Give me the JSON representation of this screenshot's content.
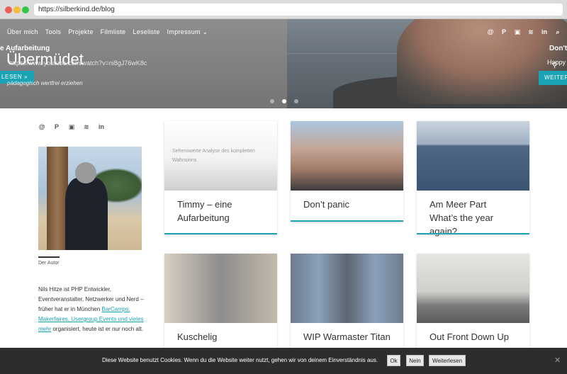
{
  "browser": {
    "url": "https://silberkind.de/blog"
  },
  "nav": {
    "items": [
      "Über mich",
      "Tools",
      "Projekte",
      "Filmliste",
      "Leseliste",
      "Impressum"
    ],
    "dropdown_suffix": "⌄"
  },
  "hero": {
    "prev_slide_title": "e Aufarbeitung",
    "big_title": "Übermüdet",
    "url_fragment": "https://www.youtube.com/watch?v=ni8gJ76wK8c",
    "left_button": "LESEN »",
    "subtitle": "pädagogisch wertfrei erziehen",
    "next_slide_title": "Don't",
    "next_slide_sub": "Happy",
    "right_button": "WEITER",
    "active_dot": 1
  },
  "sidebar": {
    "author_caption": "Der Autor",
    "bio_1": "Nils Hitze ist PHP Entwickler, Eventveranstalter, Netzwerker und Nerd – früher hat er in München ",
    "bio_link": "BarCamps, Makerfaires, Usergroup Events und vieles mehr",
    "bio_2": " organisiert, heute ist er nur noch alt."
  },
  "cards": [
    {
      "title": "Timmy – eine Aufarbeitung",
      "overlay": "Sehenswerte Analyse des kompletten Wahnsinns"
    },
    {
      "title": "Don’t panic"
    },
    {
      "title": "Am Meer Part What’s the year again?"
    },
    {
      "title": "Kuschelig"
    },
    {
      "title": "WIP Warmaster Titan"
    },
    {
      "title": "Out Front Down Up"
    }
  ],
  "cookie": {
    "text": "Diese Website benutzt Cookies. Wenn du die Website weiter nutzt, gehen wir von deinem Einverständnis aus.",
    "ok": "Ok",
    "nein": "Nein",
    "weiterlesen": "Weiterlesen",
    "close": "✕"
  },
  "icons": [
    "mastodon-icon",
    "paypal-icon",
    "chat-icon",
    "rss-icon",
    "linkedin-icon",
    "search-icon"
  ],
  "colors": {
    "accent": "#1aa2b5",
    "cookie_bg": "#2d2d2d"
  }
}
